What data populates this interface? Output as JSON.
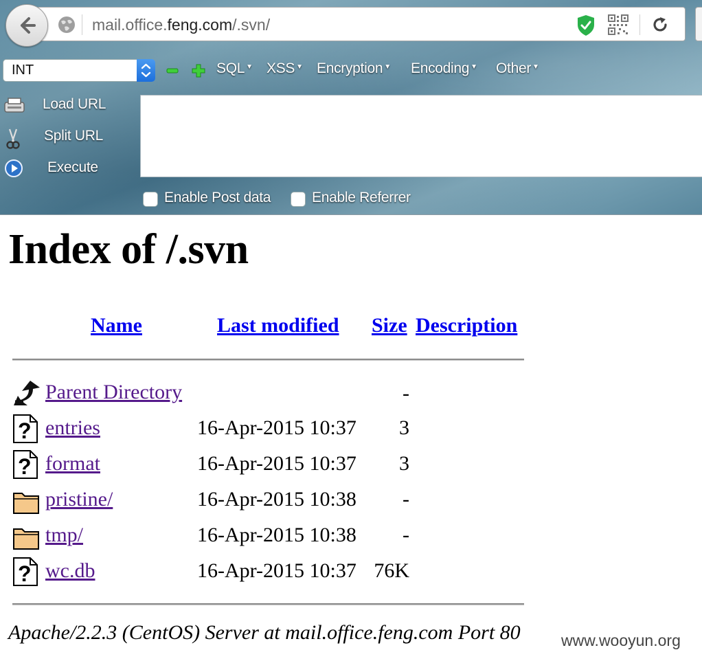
{
  "browser": {
    "url_prefix": "mail.office.",
    "url_host": "feng.com",
    "url_path": "/.svn/"
  },
  "hackbar": {
    "select_value": "INT",
    "menus": [
      "SQL",
      "XSS",
      "Encryption",
      "Encoding",
      "Other"
    ],
    "actions": {
      "load": "Load URL",
      "split": "Split URL",
      "execute": "Execute"
    },
    "url_text": "",
    "enable_post": "Enable Post data",
    "enable_referrer": "Enable Referrer"
  },
  "page": {
    "title": "Index of /.svn",
    "columns": {
      "name": "Name",
      "modified": "Last modified",
      "size": "Size",
      "description": "Description"
    },
    "rows": [
      {
        "name": "Parent Directory",
        "date": "",
        "size": "-",
        "icon": "back-icon"
      },
      {
        "name": "entries",
        "date": "16-Apr-2015 10:37",
        "size": "3",
        "icon": "unknown-file-icon"
      },
      {
        "name": "format",
        "date": "16-Apr-2015 10:37",
        "size": "3",
        "icon": "unknown-file-icon"
      },
      {
        "name": "pristine/",
        "date": "16-Apr-2015 10:38",
        "size": "-",
        "icon": "folder-icon"
      },
      {
        "name": "tmp/",
        "date": "16-Apr-2015 10:38",
        "size": "-",
        "icon": "folder-icon"
      },
      {
        "name": "wc.db",
        "date": "16-Apr-2015 10:37",
        "size": "76K",
        "icon": "unknown-file-icon"
      }
    ],
    "footer": "Apache/2.2.3 (CentOS) Server at mail.office.feng.com Port 80"
  },
  "watermark": "www.wooyun.org",
  "colors": {
    "link": "#0000ee",
    "visited": "#551a8b",
    "hackbar_bg": "#5f8ca2"
  }
}
